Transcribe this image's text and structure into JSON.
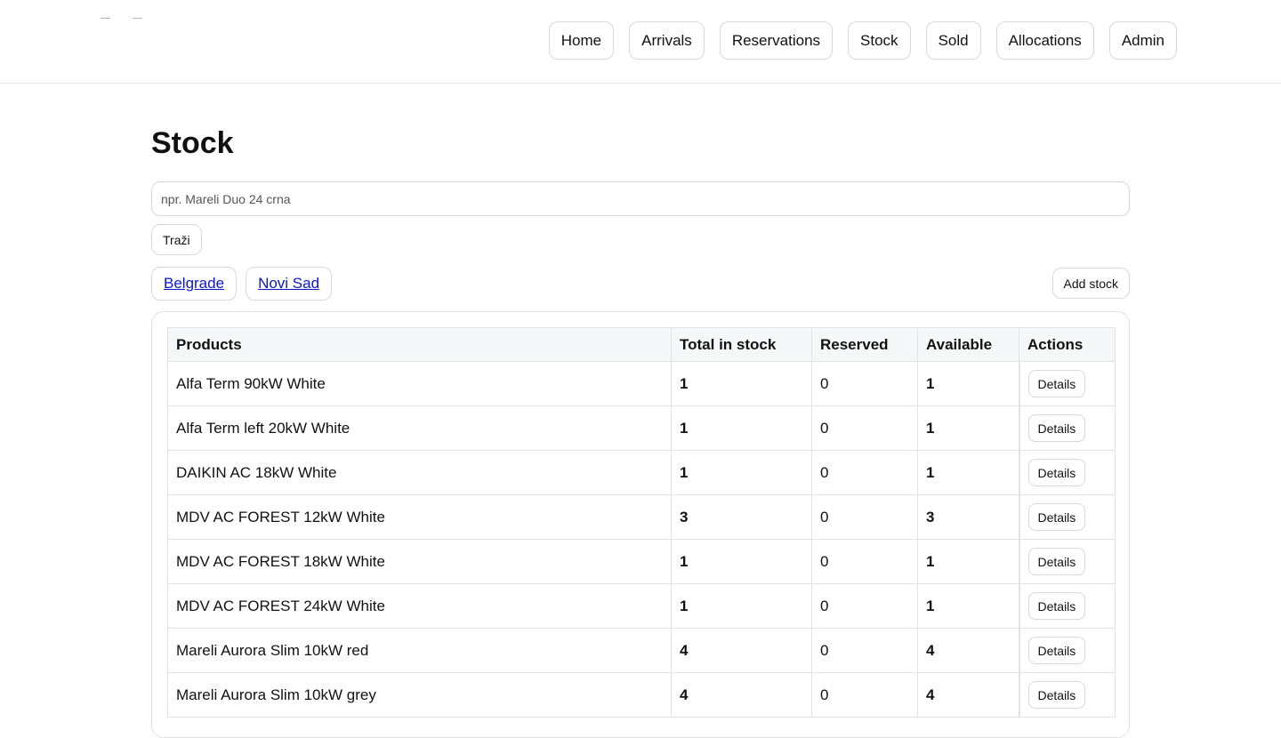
{
  "nav": {
    "items": [
      {
        "label": "Home"
      },
      {
        "label": "Arrivals"
      },
      {
        "label": "Reservations"
      },
      {
        "label": "Stock"
      },
      {
        "label": "Sold"
      },
      {
        "label": "Allocations"
      },
      {
        "label": "Admin"
      }
    ]
  },
  "page": {
    "title": "Stock"
  },
  "search": {
    "placeholder": "npr. Mareli Duo 24 crna",
    "value": "",
    "button_label": "Traži"
  },
  "locations": [
    {
      "label": "Belgrade"
    },
    {
      "label": "Novi Sad"
    }
  ],
  "toolbar": {
    "add_stock_label": "Add stock"
  },
  "table": {
    "columns": [
      "Products",
      "Total in stock",
      "Reserved",
      "Available",
      "Actions"
    ],
    "details_label": "Details",
    "rows": [
      {
        "product": "Alfa Term 90kW White",
        "total": "1",
        "reserved": "0",
        "available": "1"
      },
      {
        "product": "Alfa Term left 20kW White",
        "total": "1",
        "reserved": "0",
        "available": "1"
      },
      {
        "product": "DAIKIN AC 18kW White",
        "total": "1",
        "reserved": "0",
        "available": "1"
      },
      {
        "product": "MDV AC FOREST 12kW White",
        "total": "3",
        "reserved": "0",
        "available": "3"
      },
      {
        "product": "MDV AC FOREST 18kW White",
        "total": "1",
        "reserved": "0",
        "available": "1"
      },
      {
        "product": "MDV AC FOREST 24kW White",
        "total": "1",
        "reserved": "0",
        "available": "1"
      },
      {
        "product": "Mareli Aurora Slim 10kW red",
        "total": "4",
        "reserved": "0",
        "available": "4"
      },
      {
        "product": "Mareli Aurora Slim 10kW grey",
        "total": "4",
        "reserved": "0",
        "available": "4"
      }
    ]
  },
  "colors": {
    "link": "#0b18c8",
    "border": "#d9d9d9",
    "header_bg": "#f6f7f9"
  }
}
